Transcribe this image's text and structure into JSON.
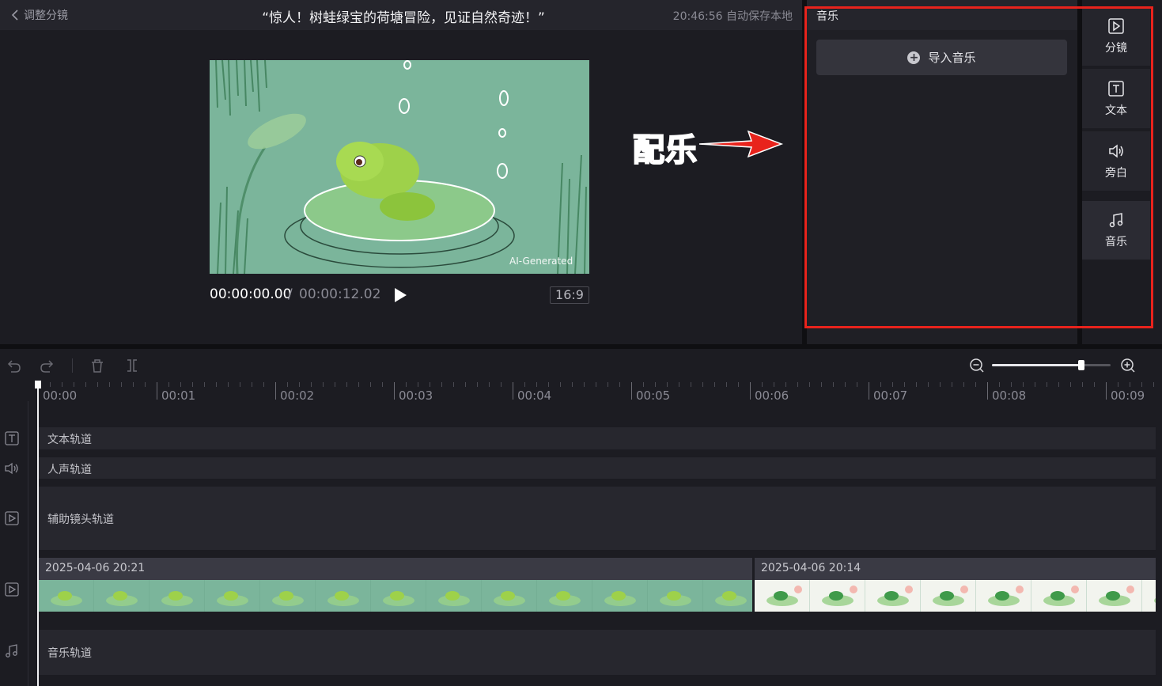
{
  "topbar": {
    "back_label": "调整分镜",
    "title": "“惊人！树蛙绿宝的荷塘冒险，见证自然奇迹！”",
    "autosave": "20:46:56 自动保存本地"
  },
  "preview": {
    "watermark": "AI-Generated",
    "time_current": "00:00:00.00",
    "time_separator": "/",
    "time_total": "00:00:12.02",
    "aspect_ratio": "16:9"
  },
  "annotation": {
    "text": "配乐",
    "color": "#e8231c"
  },
  "music_panel": {
    "title": "音乐",
    "import_label": "导入音乐"
  },
  "sidebar": {
    "items": [
      {
        "label": "分镜",
        "icon": "play-square-icon"
      },
      {
        "label": "文本",
        "icon": "text-t-icon"
      },
      {
        "label": "旁白",
        "icon": "speaker-icon"
      },
      {
        "label": "音乐",
        "icon": "music-note-icon",
        "active": true
      }
    ]
  },
  "timeline": {
    "zoom_level": 0.75,
    "ruler": [
      "00:00",
      "00:01",
      "00:02",
      "00:03",
      "00:04",
      "00:05",
      "00:06",
      "00:07",
      "00:08",
      "00:09"
    ],
    "tracks": {
      "text": "文本轨道",
      "voice": "人声轨道",
      "aux": "辅助镜头轨道",
      "music": "音乐轨道"
    },
    "clips": [
      {
        "timestamp": "2025-04-06 20:21"
      },
      {
        "timestamp": "2025-04-06 20:14"
      }
    ]
  },
  "colors": {
    "accent_red": "#e8231c",
    "panel_bg": "#1f1f25"
  }
}
